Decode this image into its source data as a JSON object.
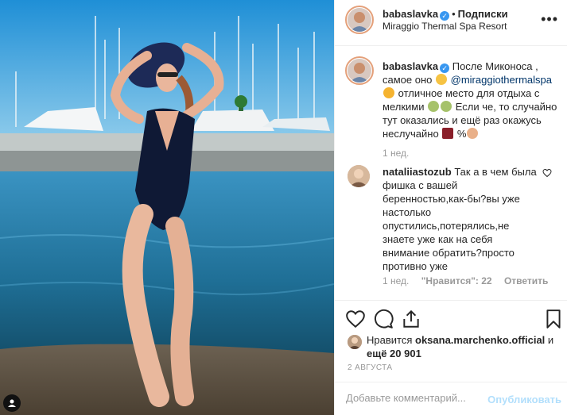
{
  "post": {
    "username": "babaslavka",
    "follow_label": "Подписки",
    "location": "Miraggio Thermal Spa Resort",
    "more_label": "•••"
  },
  "caption": {
    "username": "babaslavka",
    "part1": "После Миконоса , самое оно",
    "mention": "@miraggiothermalspa",
    "part2": "отличное место для отдыха с мелкими",
    "part3": "Если че, то случайно тут оказались и ещё раз окажусь неслучайно",
    "part4": "%",
    "time": "1 нед."
  },
  "comment": {
    "username": "nataliiastozub",
    "text": "Так а в чем была фишка с вашей беренностью,как-бы?вы уже настолько опустились,потерялись,не знаете уже как на себя внимание обратить?просто противно уже",
    "time": "1 нед.",
    "likes": "\"Нравится\": 22",
    "reply_label": "Ответить"
  },
  "likes": {
    "prefix": "Нравится",
    "user": "oksana.marchenko.official",
    "middle": "и",
    "rest": "ещё 20 901"
  },
  "date": "2 АВГУСТА",
  "add_comment": {
    "placeholder": "Добавьте комментарий...",
    "publish_label": "Опубликовать"
  },
  "icons": {
    "like": "heart-icon",
    "comment": "comment-icon",
    "share": "share-icon",
    "save": "bookmark-icon",
    "verified": "verified-badge-icon",
    "user_tag": "user-tag-icon"
  },
  "colors": {
    "verified": "#3897f0",
    "mention": "#003569",
    "publish": "#b2dffc",
    "secondary_text": "#999999"
  }
}
